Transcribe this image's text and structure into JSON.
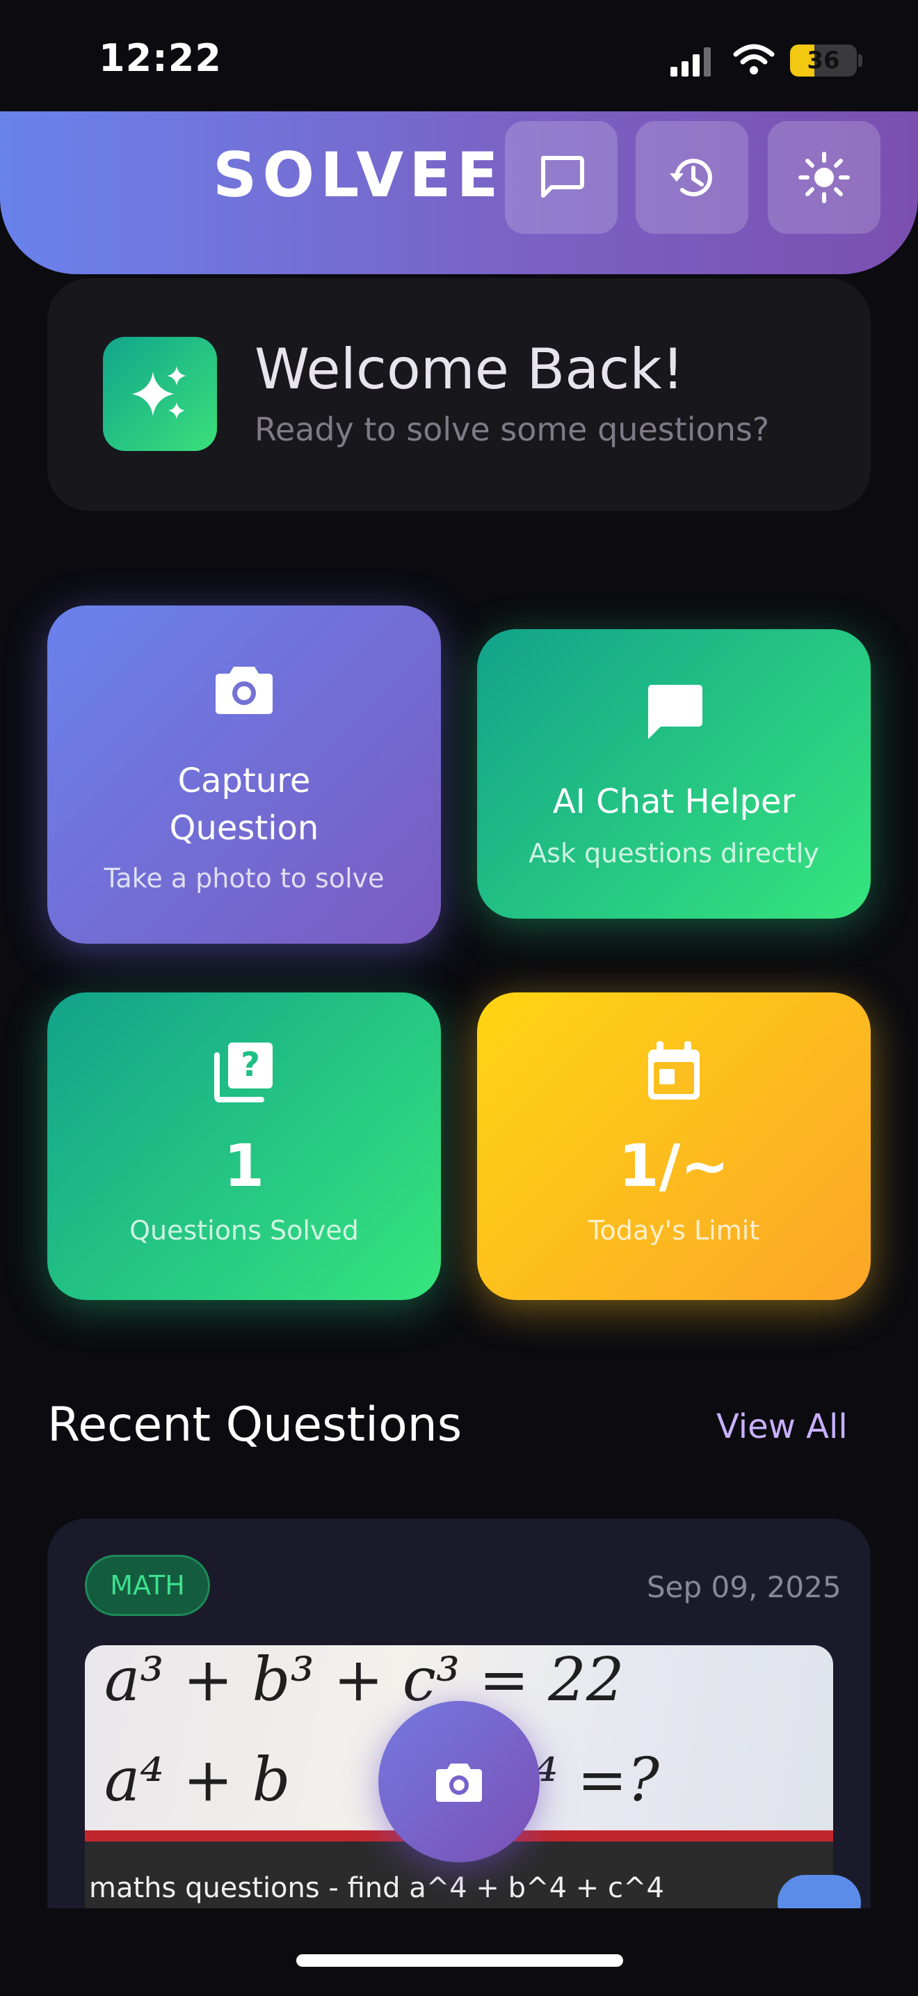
{
  "status_bar": {
    "time": "12:22",
    "battery": "36",
    "battery_level": 0.36
  },
  "header": {
    "brand": "SOLVEE",
    "buttons": [
      {
        "icon": "chat-bubble-icon"
      },
      {
        "icon": "history-icon"
      },
      {
        "icon": "sun-icon"
      }
    ]
  },
  "welcome": {
    "title": "Welcome Back!",
    "subtitle": "Ready to solve some questions?",
    "icon": "sparkles-icon"
  },
  "actions": {
    "capture": {
      "title_line1": "Capture",
      "title_line2": "Question",
      "subtitle": "Take a photo to solve",
      "icon": "camera-icon"
    },
    "chat": {
      "title": "AI Chat Helper",
      "subtitle": "Ask questions directly",
      "icon": "chat-icon"
    }
  },
  "stats": {
    "solved": {
      "value": "1",
      "label": "Questions Solved",
      "icon": "question-library-icon"
    },
    "limit": {
      "value": "1/~",
      "label": "Today's Limit",
      "icon": "calendar-icon"
    }
  },
  "recent": {
    "title": "Recent Questions",
    "view_all": "View All",
    "items": [
      {
        "tag": "MATH",
        "date": "Sep 09, 2025",
        "equation_1": "a³ + b³ + c³ = 22",
        "equation_2": "a⁴ + b",
        "equation_2_end": "⁴ =?",
        "caption": "maths questions - find a^4 + b^4 + c^4"
      }
    ]
  },
  "colors": {
    "header_start": "#6a82ec",
    "header_end": "#7b4fb0",
    "green": "#36e57d",
    "yellow": "#ffd513",
    "tag_text": "#3de08c",
    "link": "#c9b0ff"
  }
}
